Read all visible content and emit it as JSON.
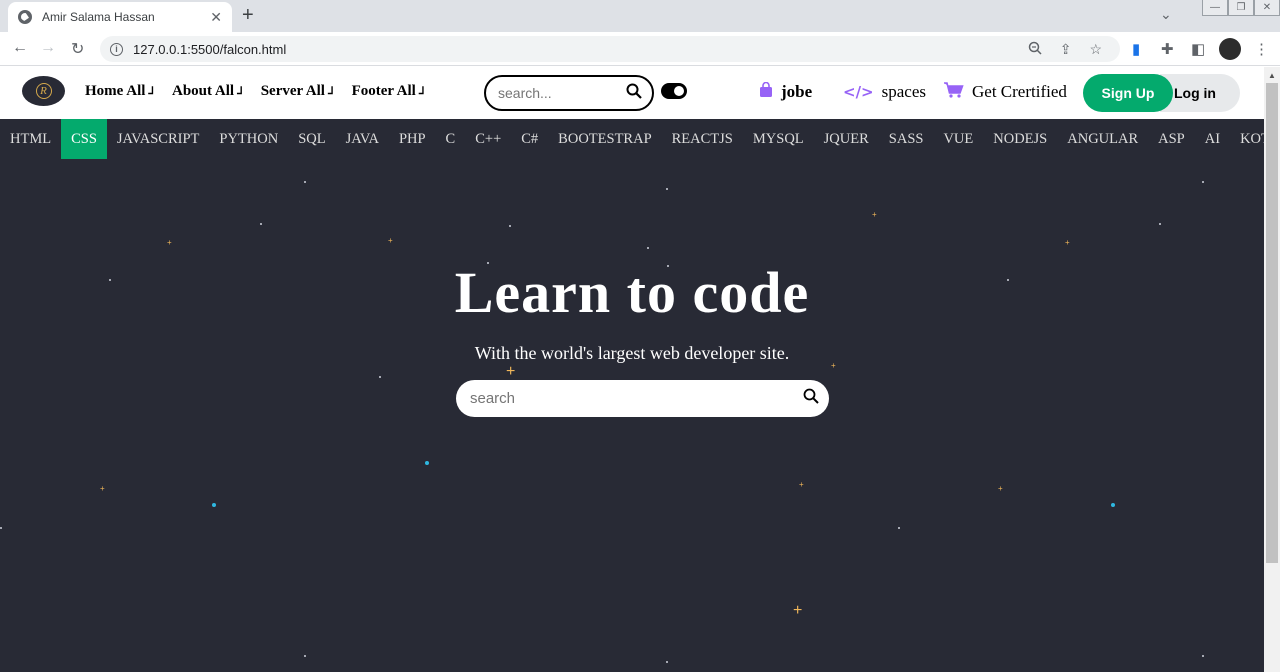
{
  "browser": {
    "tab_title": "Amir Salama Hassan",
    "url": "127.0.0.1:5500/falcon.html",
    "newtab_label": "+",
    "tab_close": "✕"
  },
  "header": {
    "nav": [
      {
        "label": "Home All",
        "caret": "⅃"
      },
      {
        "label": "About All",
        "caret": "⅃"
      },
      {
        "label": "Server All",
        "caret": "⅃"
      },
      {
        "label": "Footer All",
        "caret": "⅃"
      }
    ],
    "search_placeholder": "search...",
    "jobe_label": "jobe",
    "spaces_label": "spaces",
    "certified_label": "Get Crertified",
    "signup_label": "Sign Up",
    "login_label": "Log in"
  },
  "topics": [
    "HTML",
    "CSS",
    "JAVASCRIPT",
    "PYTHON",
    "SQL",
    "JAVA",
    "PHP",
    "C",
    "C++",
    "C#",
    "BOOTESTRAP",
    "REACTJS",
    "MYSQL",
    "JQUER",
    "SASS",
    "VUE",
    "NODEJS",
    "ANGULAR",
    "ASP",
    "AI",
    "KOTLIN"
  ],
  "active_topic": "CSS",
  "hero": {
    "title": "Learn to code",
    "subtitle": "With the world's largest web developer site.",
    "search_placeholder": "search"
  },
  "colors": {
    "accent_green": "#04aa6d",
    "hero_bg": "#282a35",
    "purple_icon": "#9763f6"
  }
}
